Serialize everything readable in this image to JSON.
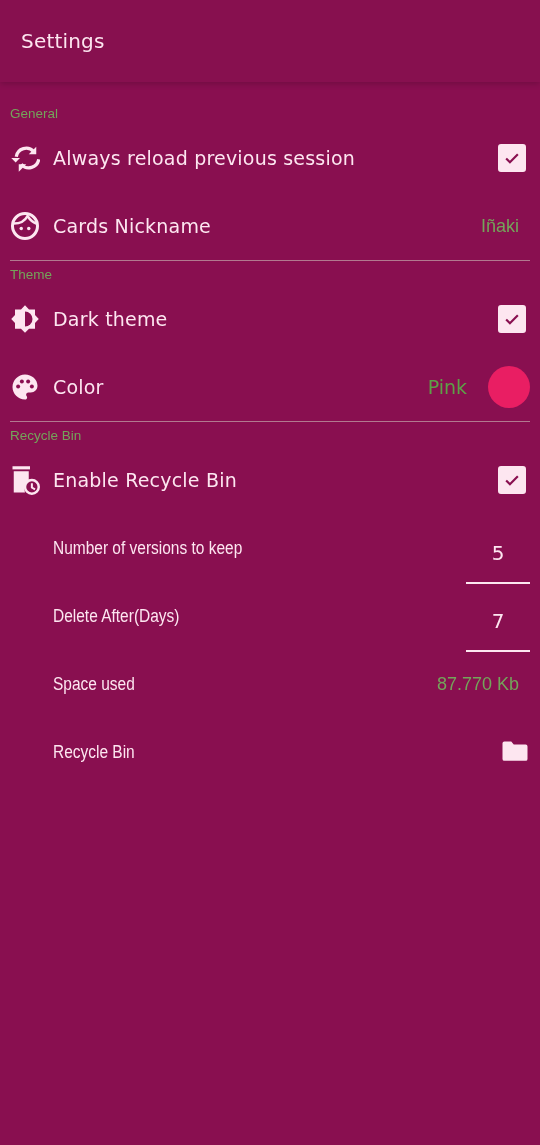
{
  "app_bar": {
    "title": "Settings"
  },
  "sections": [
    {
      "title": "General",
      "rows": [
        {
          "kind": "check",
          "label": "Always reload previous session",
          "checked": true
        },
        {
          "kind": "value",
          "label": "Cards Nickname",
          "value": "Iñaki"
        }
      ]
    },
    {
      "title": "Theme",
      "rows": [
        {
          "kind": "check",
          "label": "Dark theme",
          "checked": true
        },
        {
          "kind": "color",
          "label": "Color",
          "value": "Pink",
          "color": "#e91e63"
        }
      ]
    },
    {
      "title": "Recycle Bin",
      "rows": [
        {
          "kind": "check",
          "label": "Enable Recycle Bin",
          "checked": true
        },
        {
          "kind": "number",
          "label": "Number of versions to keep",
          "value": "5"
        },
        {
          "kind": "number",
          "label": "Delete After(Days)",
          "value": "7"
        },
        {
          "kind": "info",
          "label": "Space used",
          "value": "87.770 Kb"
        },
        {
          "kind": "folder",
          "label": "Recycle Bin"
        }
      ]
    }
  ]
}
